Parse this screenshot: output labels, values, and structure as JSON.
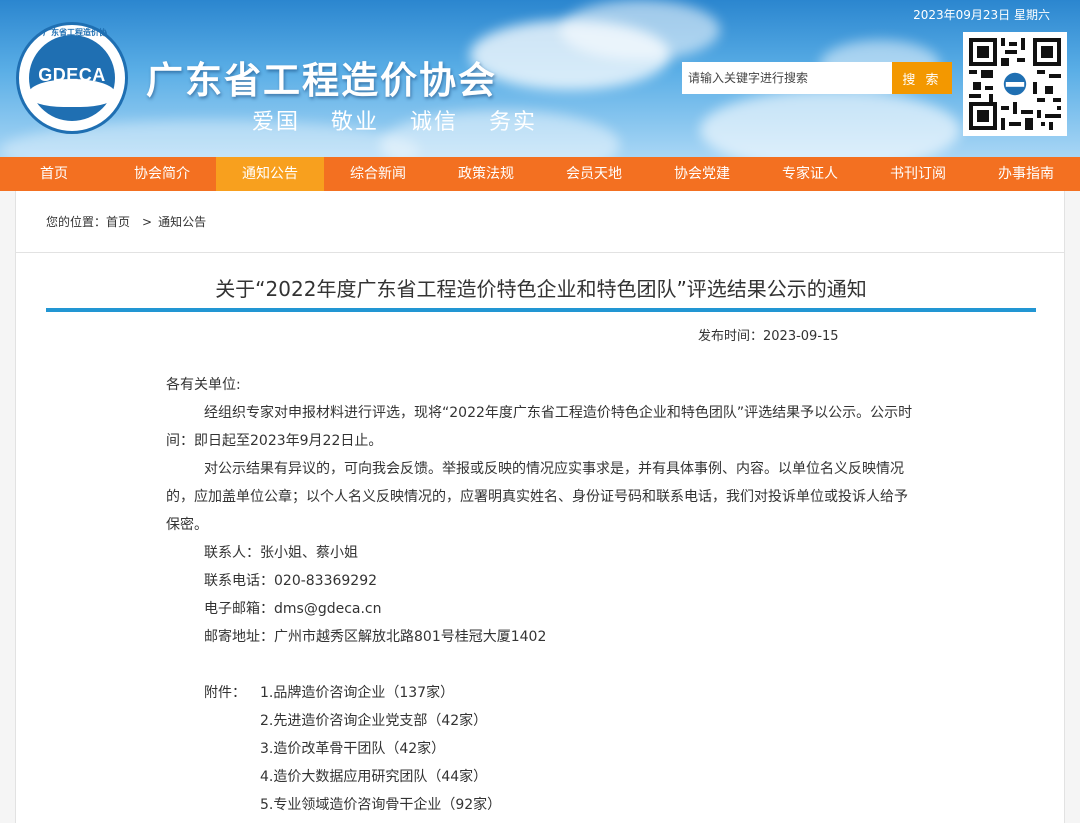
{
  "header": {
    "date": "2023年09月23日 星期六",
    "logo_text": "GDECA",
    "logo_ring_text": "广东省工程造价协会",
    "site_title": "广东省工程造价协会",
    "motto": [
      "爱国",
      "敬业",
      "诚信",
      "务实"
    ],
    "search_placeholder": "请输入关键字进行搜索",
    "search_button": "搜 索"
  },
  "nav": {
    "items": [
      "首页",
      "协会简介",
      "通知公告",
      "综合新闻",
      "政策法规",
      "会员天地",
      "协会党建",
      "专家证人",
      "书刊订阅",
      "办事指南"
    ],
    "active_index": 2
  },
  "breadcrumb": {
    "prefix": "您的位置：",
    "home": "首页",
    "separator": ">",
    "current": "通知公告"
  },
  "article": {
    "title": "关于“2022年度广东省工程造价特色企业和特色团队”评选结果公示的通知",
    "publish_date": "发布时间：2023-09-15",
    "greeting": "各有关单位:",
    "paragraph1": "经组织专家对申报材料进行评选，现将“2022年度广东省工程造价特色企业和特色团队”评选结果予以公示。公示时间：即日起至2023年9月22日止。",
    "paragraph2": "对公示结果有异议的，可向我会反馈。举报或反映的情况应实事求是，并有具体事例、内容。以单位名义反映情况的，应加盖单位公章；以个人名义反映情况的，应署明真实姓名、身份证号码和联系电话，我们对投诉单位或投诉人给予保密。",
    "contact": "联系人：张小姐、蔡小姐",
    "phone": "联系电话：020-83369292",
    "email": "电子邮箱：dms@gdeca.cn",
    "address": "邮寄地址：广州市越秀区解放北路801号桂冠大厦1402",
    "attachments_label": "附件：",
    "attachments": [
      "1.品牌造价咨询企业（137家）",
      "2.先进造价咨询企业党支部（42家）",
      "3.造价改革骨干团队（42家）",
      "4.造价大数据应用研究团队（44家）",
      "5.专业领域造价咨询骨干企业（92家）"
    ]
  },
  "colors": {
    "nav_bg": "#f37021",
    "nav_active": "#f8a01e",
    "search_button": "#f39800",
    "title_rule": "#2296d3",
    "logo_blue": "#1f6fb2"
  }
}
